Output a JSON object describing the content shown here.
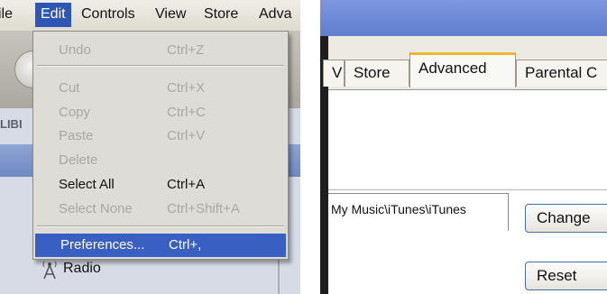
{
  "menubar": {
    "items": [
      "ile",
      "Edit",
      "Controls",
      "View",
      "Store",
      "Adva"
    ],
    "active": "Edit"
  },
  "edit_menu": {
    "items": [
      {
        "label": "Undo",
        "shortcut": "Ctrl+Z",
        "enabled": false
      },
      {
        "label": "Cut",
        "shortcut": "Ctrl+X",
        "enabled": false
      },
      {
        "label": "Copy",
        "shortcut": "Ctrl+C",
        "enabled": false
      },
      {
        "label": "Paste",
        "shortcut": "Ctrl+V",
        "enabled": false
      },
      {
        "label": "Delete",
        "shortcut": "",
        "enabled": false
      },
      {
        "label": "Select All",
        "shortcut": "Ctrl+A",
        "enabled": true
      },
      {
        "label": "Select None",
        "shortcut": "Ctrl+Shift+A",
        "enabled": false
      },
      {
        "label": "Preferences...",
        "shortcut": "Ctrl+,",
        "enabled": true,
        "highlighted": true
      }
    ]
  },
  "sidebar": {
    "library_header": "LIBI",
    "radio_label": "Radio"
  },
  "preferences": {
    "tabs": [
      "V",
      "Store",
      "Advanced",
      "Parental C"
    ],
    "active_tab": "Advanced",
    "folder_path": "My Music\\iTunes\\iTunes",
    "change_button": "Change",
    "reset_button": "Reset"
  },
  "colors": {
    "menu_highlight": "#3a5fc2",
    "active_tab_accent": "#f0b830",
    "titlebar": "#6a87d4"
  }
}
